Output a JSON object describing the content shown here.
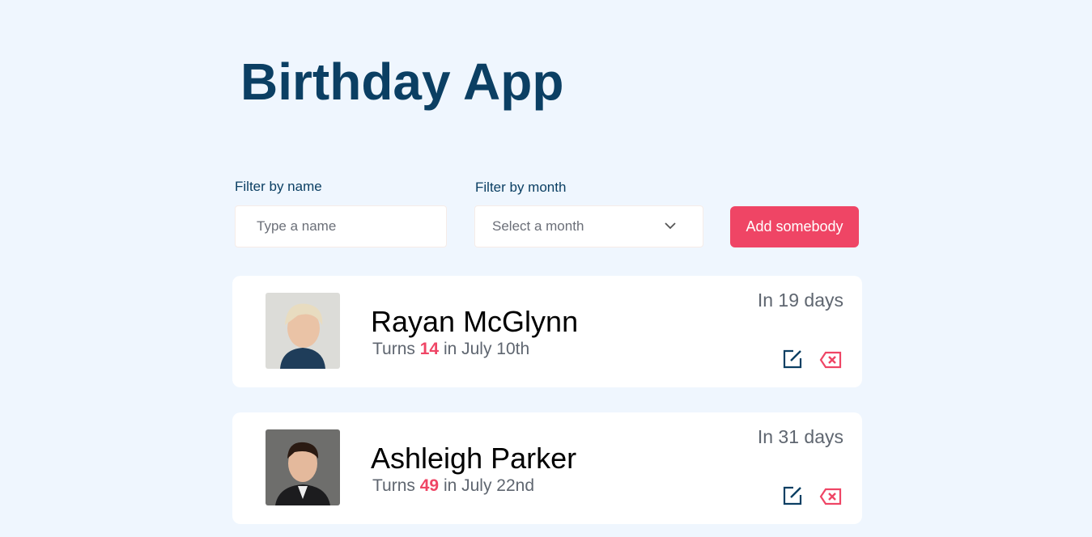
{
  "app": {
    "title": "Birthday App"
  },
  "filters": {
    "name_label": "Filter by name",
    "name_placeholder": "Type a name",
    "name_value": "",
    "month_label": "Filter by month",
    "month_value": "Select a month",
    "add_button": "Add somebody"
  },
  "colors": {
    "title": "#0b3f63",
    "accent": "#ef4565",
    "background": "#eff6fe"
  },
  "people": [
    {
      "name": "Rayan McGlynn",
      "turns_prefix": "Turns",
      "age": "14",
      "date_text": "in July 10th",
      "countdown": "In 19 days",
      "icons": [
        "edit-icon",
        "delete-icon"
      ]
    },
    {
      "name": "Ashleigh Parker",
      "turns_prefix": "Turns",
      "age": "49",
      "date_text": "in July 22nd",
      "countdown": "In 31 days",
      "icons": [
        "edit-icon",
        "delete-icon"
      ]
    }
  ]
}
